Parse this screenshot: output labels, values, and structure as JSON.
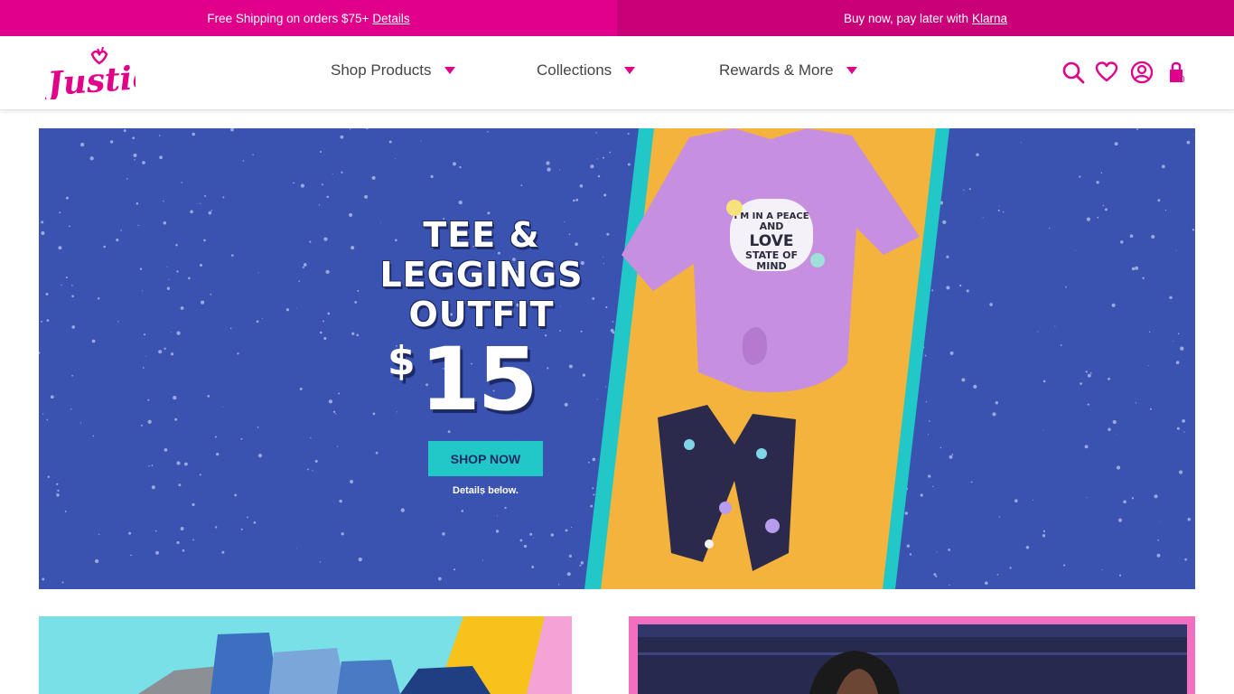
{
  "promo": {
    "left_text": "Free Shipping on orders $75+",
    "left_link": "Details",
    "right_text": "Buy now, pay later with",
    "right_link": "Klarna"
  },
  "header": {
    "logo_text": "Justice",
    "nav": [
      {
        "label": "Shop Products"
      },
      {
        "label": "Collections"
      },
      {
        "label": "Rewards & More"
      }
    ],
    "bag_count": "0",
    "icons": [
      "search-icon",
      "heart-icon",
      "user-icon",
      "bag-icon"
    ]
  },
  "hero": {
    "line1": "TEE &",
    "line2": "LEGGINGS",
    "line3": "OUTFIT",
    "price_sign": "$",
    "price": "15",
    "cta": "SHOP NOW",
    "fineprint": "Details below.",
    "tee_text": [
      "I'M IN A PEACE",
      "AND",
      "LOVE",
      "STATE OF",
      "MIND"
    ]
  },
  "colors": {
    "brand": "#e0008a",
    "hero_bg": "#3a52b0",
    "stripe_yellow": "#f3b33d",
    "stripe_teal": "#21c8c7"
  }
}
